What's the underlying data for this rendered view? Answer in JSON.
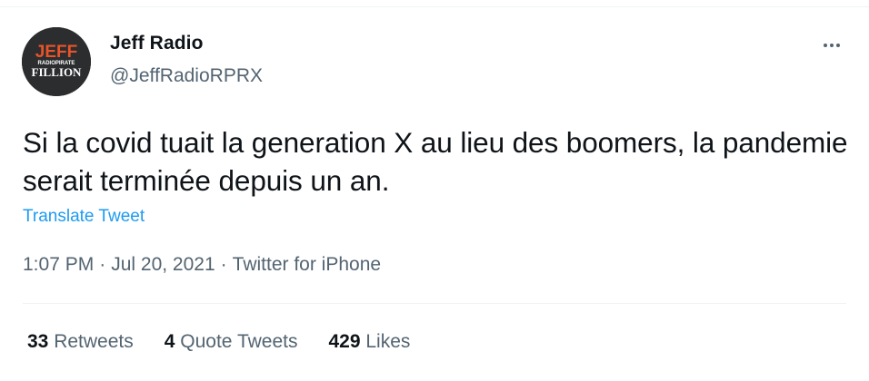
{
  "author": {
    "display_name": "Jeff Radio",
    "handle": "@JeffRadioRPRX",
    "avatar_text": [
      "JEFF",
      "RADIOPIRATE",
      "FILLION"
    ]
  },
  "tweet": {
    "text": "Si la covid tuait la generation X au lieu des boomers, la pandemie serait terminée depuis un an.",
    "translate_label": "Translate Tweet",
    "time": "1:07 PM",
    "date": "Jul 20, 2021",
    "source": "Twitter for iPhone",
    "separator": "·"
  },
  "stats": {
    "retweets_count": "33",
    "retweets_label": "Retweets",
    "quotes_count": "4",
    "quotes_label": "Quote Tweets",
    "likes_count": "429",
    "likes_label": "Likes"
  },
  "icons": {
    "more": "more-horizontal-icon"
  },
  "colors": {
    "text_primary": "#0f1419",
    "text_secondary": "#536471",
    "link": "#1d9bf0",
    "divider": "#eff3f4",
    "avatar_bg": "#2b2d2f",
    "avatar_accent": "#e8542a"
  }
}
